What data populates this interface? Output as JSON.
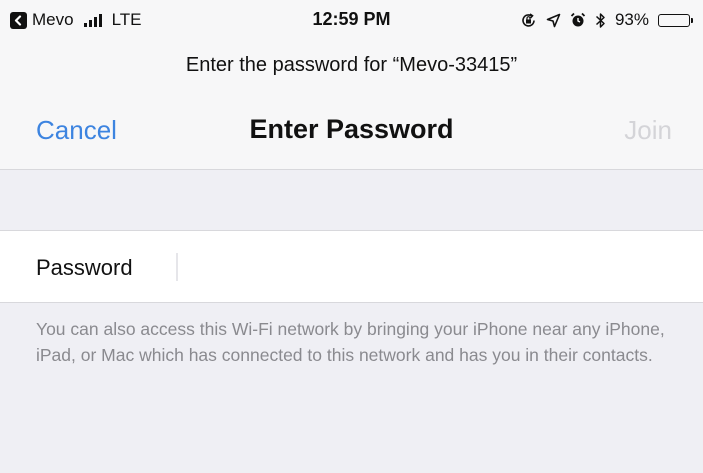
{
  "status_bar": {
    "back_app": "Mevo",
    "carrier": "LTE",
    "time": "12:59 PM",
    "battery_percent": "93%",
    "battery_level": 0.93,
    "icons": [
      "back-arrow-icon",
      "signal-bars-icon",
      "screen-lock-rotation-icon",
      "location-arrow-icon",
      "alarm-icon",
      "bluetooth-icon",
      "battery-icon"
    ]
  },
  "prompt": "Enter the password for “Mevo-33415”",
  "nav": {
    "cancel_label": "Cancel",
    "title": "Enter Password",
    "join_label": "Join"
  },
  "form": {
    "password_label": "Password",
    "password_value": ""
  },
  "footnote": "You can also access this Wi-Fi network by bringing your iPhone near any iPhone, iPad, or Mac which has connected to this network and has you in their contacts.",
  "colors": {
    "accent": "#3d84e0",
    "disabled": "#d4d4d8",
    "background": "#efeff4",
    "footnote_text": "#8a8a8f"
  }
}
